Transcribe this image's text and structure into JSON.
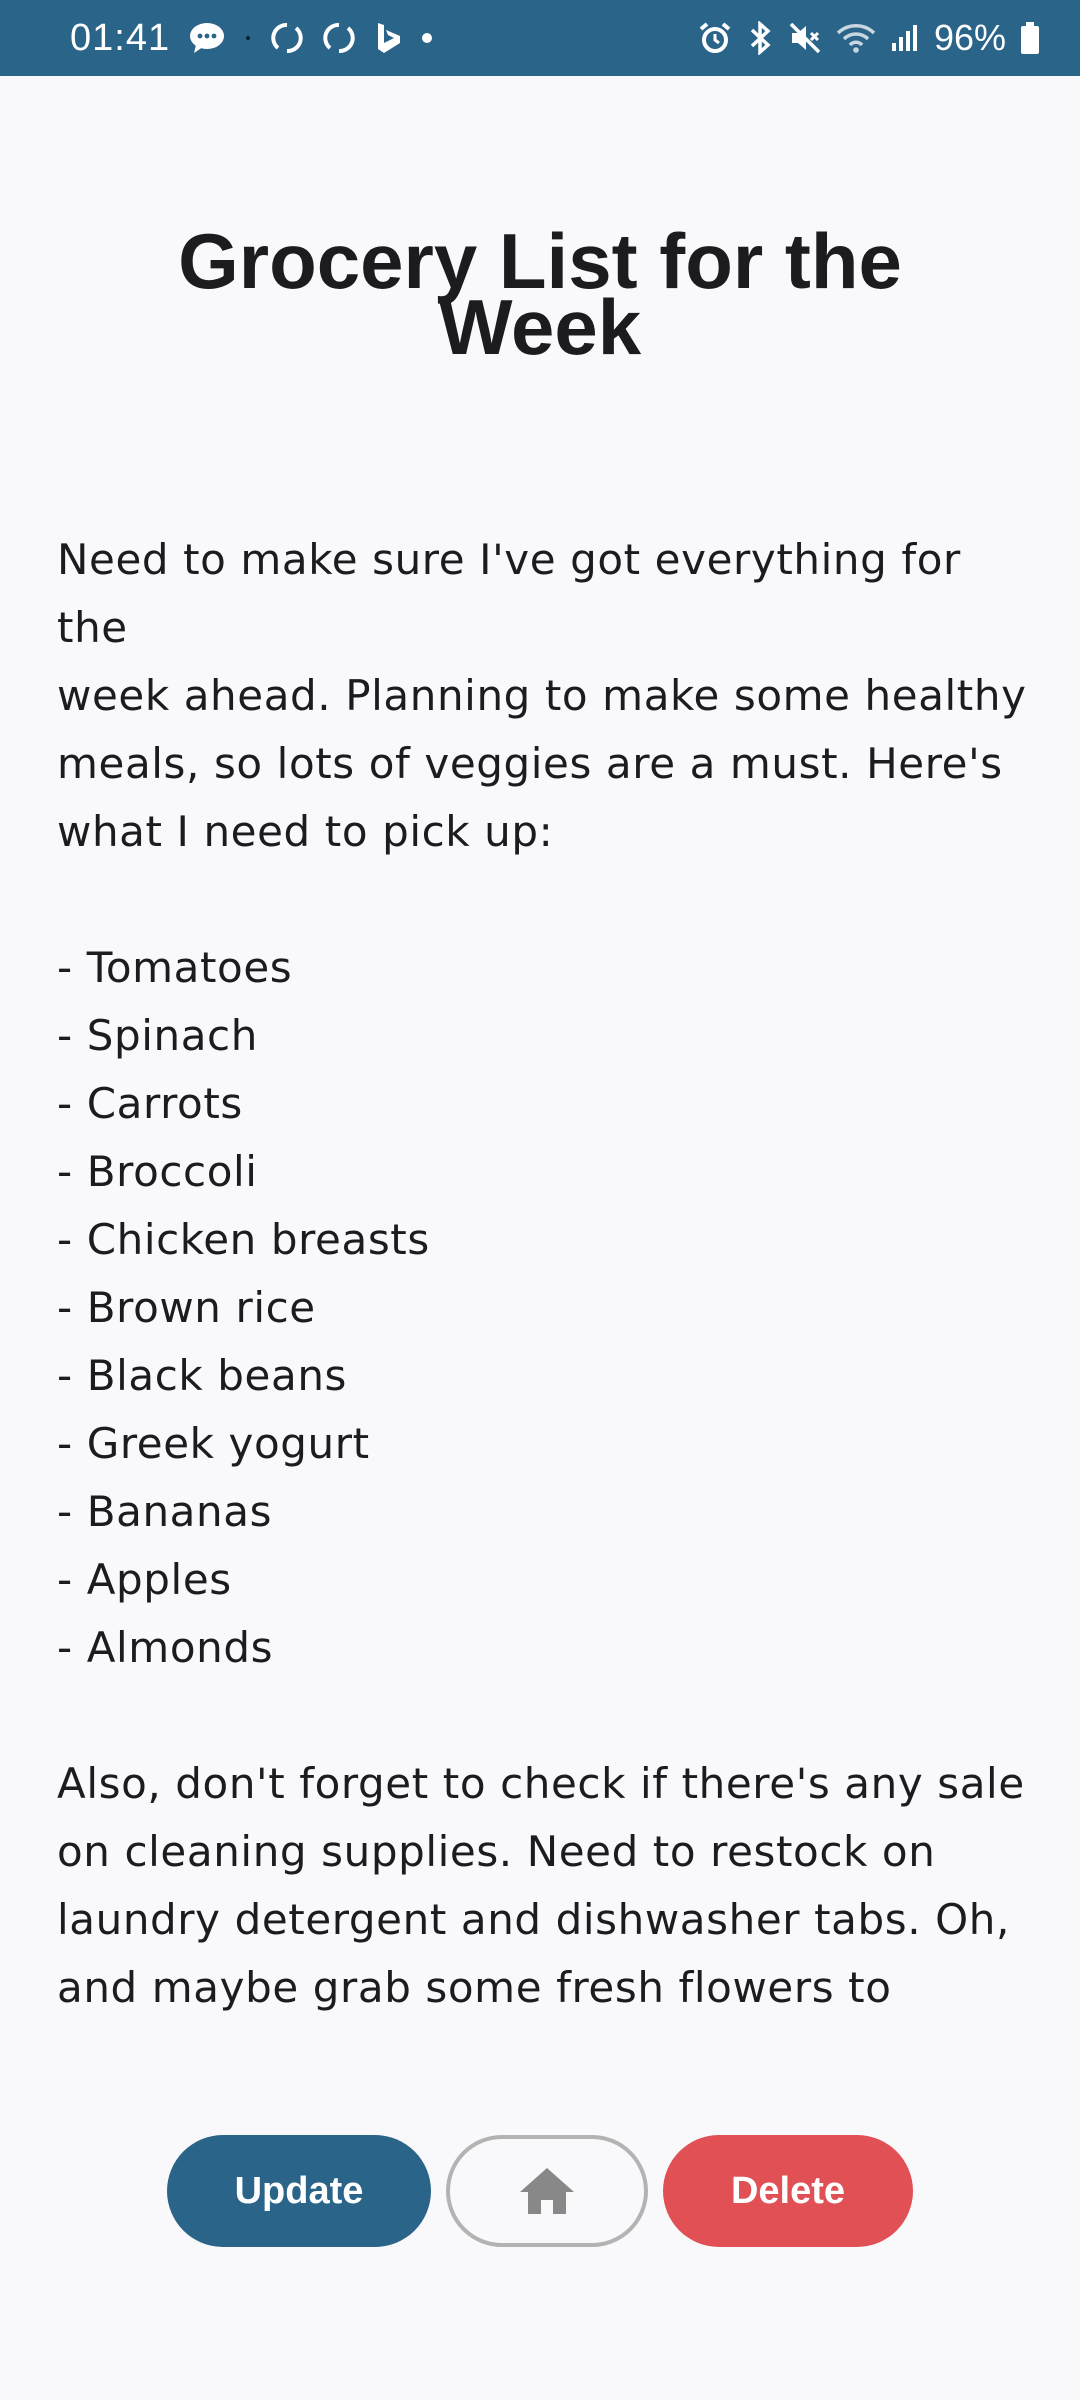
{
  "status_bar": {
    "time": "01:41",
    "battery": "96%",
    "left_icons": [
      "chat-bubble-icon",
      "dot-icon",
      "sync-icon",
      "sync-icon",
      "bing-icon",
      "dot-icon"
    ],
    "right_icons": [
      "alarm-icon",
      "bluetooth-icon",
      "mute-icon",
      "wifi-icon",
      "signal-icon",
      "battery-icon"
    ],
    "color": "#2b6489"
  },
  "note": {
    "title": "Grocery List for the Week",
    "intro_lines": [
      "Need to make sure I've got everything for the",
      "week ahead. Planning to make some healthy",
      "meals, so lots of veggies are a must. Here's",
      "what I need to pick up:"
    ],
    "items": [
      "- Tomatoes",
      "- Spinach",
      "- Carrots",
      "- Broccoli",
      "- Chicken breasts",
      "- Brown rice",
      "- Black beans",
      "- Greek yogurt",
      "- Bananas",
      "- Apples",
      "- Almonds"
    ],
    "outro_lines": [
      "Also, don't forget to check if there's any sale",
      "on cleaning supplies. Need to restock on",
      "laundry detergent and dishwasher tabs. Oh,",
      "and maybe grab some fresh flowers to"
    ]
  },
  "actions": {
    "update_label": "Update",
    "home_icon": "home-icon",
    "delete_label": "Delete",
    "update_color": "#2b6489",
    "delete_color": "#e05055"
  }
}
